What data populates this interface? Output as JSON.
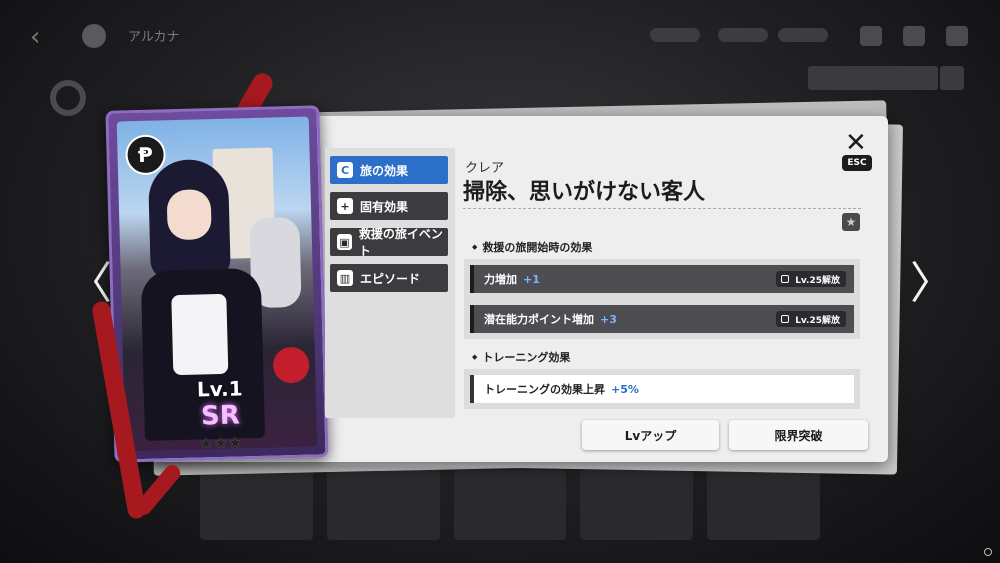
{
  "header": {
    "title": "アルカナ"
  },
  "card": {
    "emblem": "Ᵽ",
    "level": "Lv.1",
    "rarity": "SR",
    "stars": "★★★"
  },
  "tabs": [
    {
      "label": "旅の効果",
      "icon": "compass-icon",
      "active": true
    },
    {
      "label": "固有効果",
      "icon": "plus-card-icon",
      "active": false
    },
    {
      "label": "救援の旅イベント",
      "icon": "gift-icon",
      "active": false
    },
    {
      "label": "エピソード",
      "icon": "book-icon",
      "active": false
    }
  ],
  "content": {
    "character": "クレア",
    "title": "掃除、思いがけない客人",
    "close_label": "ESC",
    "section1": "救援の旅開始時の効果",
    "effects1": [
      {
        "name": "力増加",
        "value": "+1",
        "lock": "Lv.25解放"
      },
      {
        "name": "潜在能力ポイント増加",
        "value": "+3",
        "lock": "Lv.25解放"
      }
    ],
    "section2": "トレーニング効果",
    "effects2": [
      {
        "name": "トレーニングの効果上昇",
        "value": "+5%"
      }
    ]
  },
  "buttons": {
    "lvup": "Lvアップ",
    "limit": "限界突破"
  },
  "colors": {
    "active_tab": "#2b6fc9",
    "accent_value": "#2b6fc9",
    "rarity_glow": "#e36cff"
  }
}
